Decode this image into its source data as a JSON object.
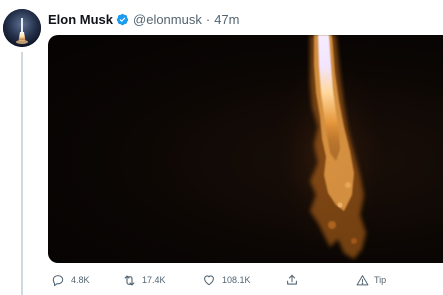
{
  "tweet": {
    "author": {
      "name": "Elon Musk",
      "handle": "@elonmusk",
      "verified": true
    },
    "separator": "·",
    "time": "47m",
    "media": {
      "type": "video"
    },
    "actions": {
      "reply_count": "4.8K",
      "retweet_count": "17.4K",
      "like_count": "108.1K",
      "share_label": "",
      "tip_label": "Tip"
    }
  },
  "icons": {
    "reply": "reply-icon",
    "retweet": "retweet-icon",
    "like": "heart-icon",
    "share": "share-icon",
    "tip": "tip-icon",
    "verified": "verified-badge-icon"
  },
  "colors": {
    "verified_badge": "#1d9bf0",
    "muted_text": "#536471",
    "media_background": "#0b0604",
    "flame_core": "#f3e8ff",
    "flame_outer": "#d98a2e"
  }
}
